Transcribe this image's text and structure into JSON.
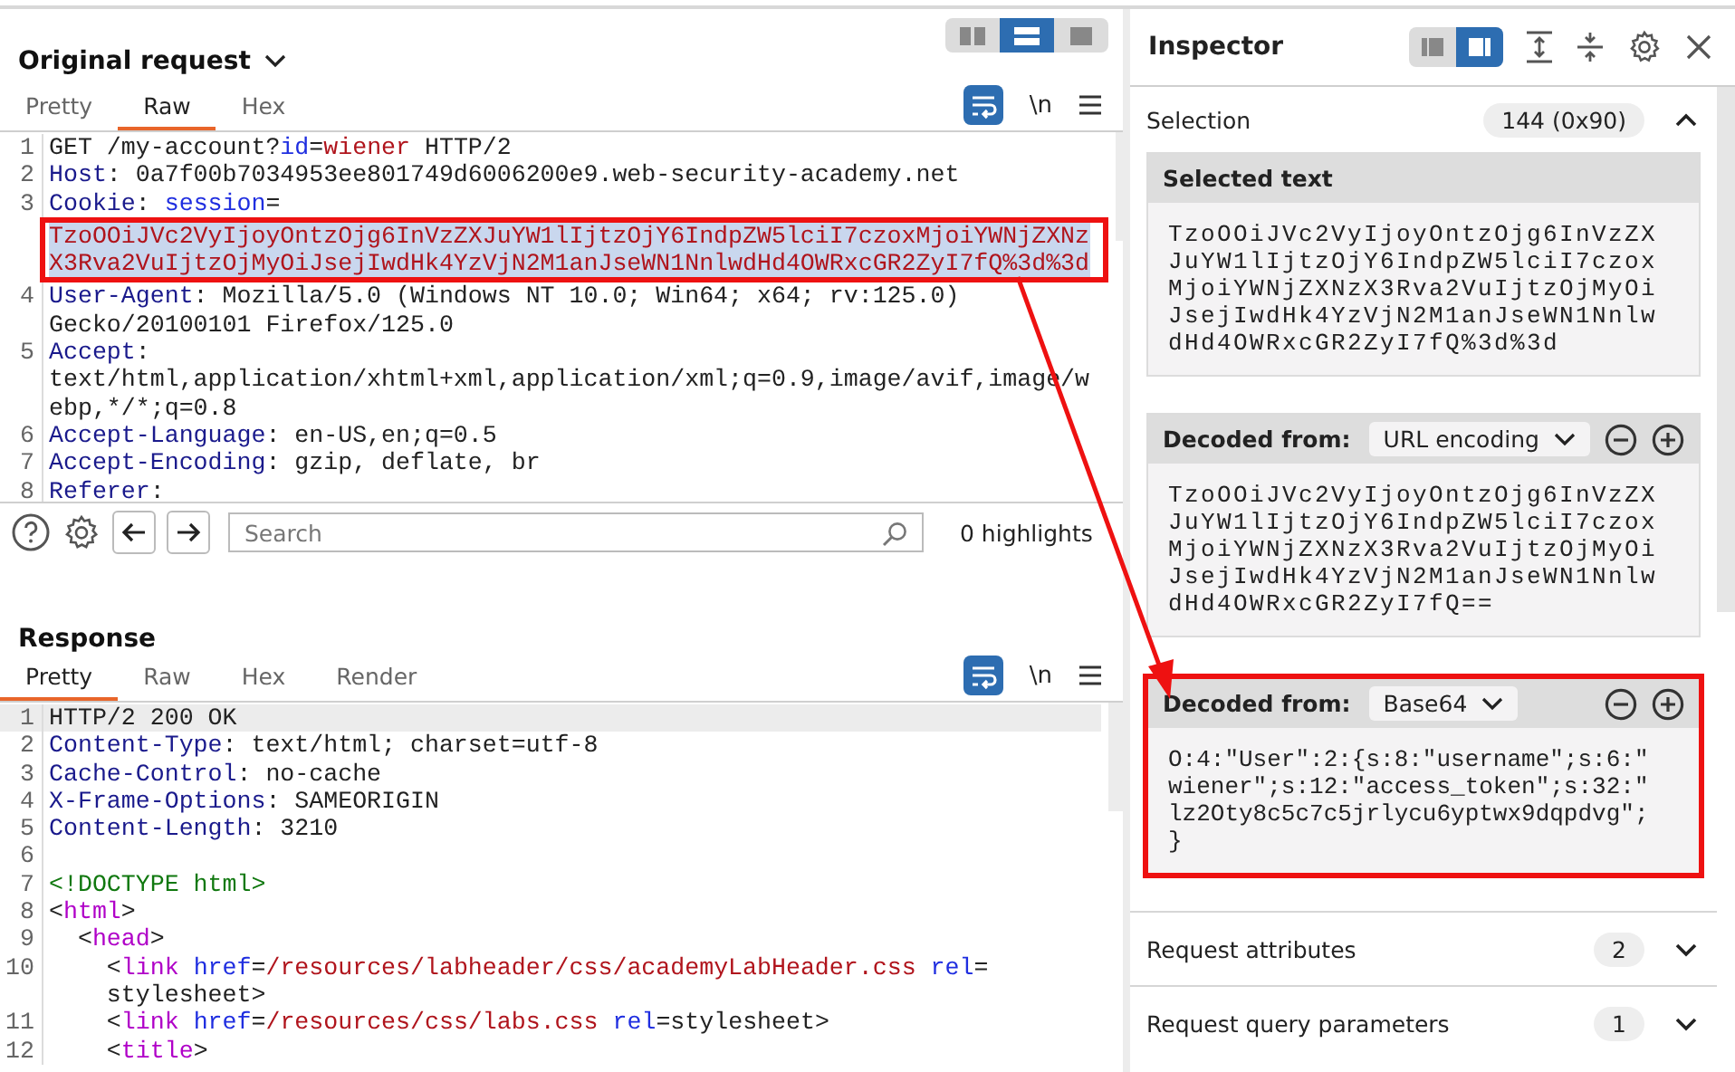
{
  "request": {
    "title": "Original request",
    "layout_modes": [
      {
        "selected": false
      },
      {
        "selected": true
      },
      {
        "selected": false
      }
    ],
    "tabs": [
      {
        "label": "Pretty",
        "selected": false
      },
      {
        "label": "Raw",
        "selected": true
      },
      {
        "label": "Hex",
        "selected": false
      }
    ],
    "wrap_on": true,
    "newline_label": "\\n",
    "lines": [
      {
        "number": "1",
        "rows": [
          [
            {
              "kind": "plain",
              "text": "GET /my-account?"
            },
            {
              "kind": "param",
              "text": "id"
            },
            {
              "kind": "plain",
              "text": "="
            },
            {
              "kind": "val",
              "text": "wiener"
            },
            {
              "kind": "plain",
              "text": " HTTP/2"
            }
          ]
        ]
      },
      {
        "number": "2",
        "rows": [
          [
            {
              "kind": "key",
              "text": "Host"
            },
            {
              "kind": "plain",
              "text": ": 0a7f00b7034953ee801749d6006200e9.web-security-academy.net"
            }
          ]
        ]
      },
      {
        "number": "3",
        "rows": [
          [
            {
              "kind": "key",
              "text": "Cookie"
            },
            {
              "kind": "plain",
              "text": ": "
            },
            {
              "kind": "param",
              "text": "session"
            },
            {
              "kind": "plain",
              "text": "="
            }
          ]
        ],
        "boxed_rows": [
          [
            {
              "kind": "sel",
              "text": "TzoOOiJVc2VyIjoyOntzOjg6InVzZXJuYW1lIjtzOjY6IndpZW5lciI7czoxMjoiYWNjZXNz"
            }
          ],
          [
            {
              "kind": "sel",
              "text": "X3Rva2VuIjtzOjMyOiJsejIwdHk4YzVjN2M1anJseWN1NnlwdHd4OWRxcGR2ZyI7fQ%3d%3d"
            }
          ]
        ]
      },
      {
        "number": "4",
        "rows": [
          [
            {
              "kind": "key",
              "text": "User-Agent"
            },
            {
              "kind": "plain",
              "text": ": Mozilla/5.0 (Windows NT 10.0; Win64; x64; rv:125.0)"
            }
          ],
          [
            {
              "kind": "plain",
              "text": "Gecko/20100101 Firefox/125.0"
            }
          ]
        ]
      },
      {
        "number": "5",
        "rows": [
          [
            {
              "kind": "key",
              "text": "Accept"
            },
            {
              "kind": "plain",
              "text": ":"
            }
          ],
          [
            {
              "kind": "plain",
              "text": "text/html,application/xhtml+xml,application/xml;q=0.9,image/avif,image/w"
            }
          ],
          [
            {
              "kind": "plain",
              "text": "ebp,*/*;q=0.8"
            }
          ]
        ]
      },
      {
        "number": "6",
        "rows": [
          [
            {
              "kind": "key",
              "text": "Accept-Language"
            },
            {
              "kind": "plain",
              "text": ": en-US,en;q=0.5"
            }
          ]
        ]
      },
      {
        "number": "7",
        "rows": [
          [
            {
              "kind": "key",
              "text": "Accept-Encoding"
            },
            {
              "kind": "plain",
              "text": ": gzip, deflate, br"
            }
          ]
        ]
      },
      {
        "number": "8",
        "rows": [
          [
            {
              "kind": "key",
              "text": "Referer"
            },
            {
              "kind": "plain",
              "text": ":"
            }
          ]
        ]
      }
    ],
    "toolbar": {
      "search_placeholder": "Search",
      "highlights": "0 highlights"
    }
  },
  "response": {
    "title": "Response",
    "tabs": [
      {
        "label": "Pretty",
        "selected": true
      },
      {
        "label": "Raw",
        "selected": false
      },
      {
        "label": "Hex",
        "selected": false
      },
      {
        "label": "Render",
        "selected": false
      }
    ],
    "wrap_on": true,
    "newline_label": "\\n",
    "lines": [
      {
        "number": "1",
        "highlighted": true,
        "rows": [
          [
            {
              "kind": "plain",
              "text": "HTTP/2 200 OK"
            }
          ]
        ]
      },
      {
        "number": "2",
        "rows": [
          [
            {
              "kind": "key",
              "text": "Content-Type"
            },
            {
              "kind": "plain",
              "text": ": text/html; charset=utf-8"
            }
          ]
        ]
      },
      {
        "number": "3",
        "rows": [
          [
            {
              "kind": "key",
              "text": "Cache-Control"
            },
            {
              "kind": "plain",
              "text": ": no-cache"
            }
          ]
        ]
      },
      {
        "number": "4",
        "rows": [
          [
            {
              "kind": "key",
              "text": "X-Frame-Options"
            },
            {
              "kind": "plain",
              "text": ": SAMEORIGIN"
            }
          ]
        ]
      },
      {
        "number": "5",
        "rows": [
          [
            {
              "kind": "key",
              "text": "Content-Length"
            },
            {
              "kind": "plain",
              "text": ": 3210"
            }
          ]
        ]
      },
      {
        "number": "6",
        "rows": [
          []
        ]
      },
      {
        "number": "7",
        "rows": [
          [
            {
              "kind": "doctype",
              "text": "<!DOCTYPE html>"
            }
          ]
        ]
      },
      {
        "number": "8",
        "rows": [
          [
            {
              "kind": "plain",
              "text": "<"
            },
            {
              "kind": "tag",
              "text": "html"
            },
            {
              "kind": "plain",
              "text": ">"
            }
          ]
        ]
      },
      {
        "number": "9",
        "rows": [
          [
            {
              "kind": "plain",
              "text": "  <"
            },
            {
              "kind": "tag",
              "text": "head"
            },
            {
              "kind": "plain",
              "text": ">"
            }
          ]
        ]
      },
      {
        "number": "10",
        "rows": [
          [
            {
              "kind": "plain",
              "text": "    <"
            },
            {
              "kind": "tag",
              "text": "link"
            },
            {
              "kind": "plain",
              "text": " "
            },
            {
              "kind": "param",
              "text": "href"
            },
            {
              "kind": "plain",
              "text": "="
            },
            {
              "kind": "val",
              "text": "/resources/labheader/css/academyLabHeader.css"
            },
            {
              "kind": "plain",
              "text": " "
            },
            {
              "kind": "param",
              "text": "rel"
            },
            {
              "kind": "plain",
              "text": "="
            }
          ],
          [
            {
              "kind": "plain",
              "text": "    stylesheet>"
            }
          ]
        ]
      },
      {
        "number": "11",
        "rows": [
          [
            {
              "kind": "plain",
              "text": "    <"
            },
            {
              "kind": "tag",
              "text": "link"
            },
            {
              "kind": "plain",
              "text": " "
            },
            {
              "kind": "param",
              "text": "href"
            },
            {
              "kind": "plain",
              "text": "="
            },
            {
              "kind": "val",
              "text": "/resources/css/labs.css"
            },
            {
              "kind": "plain",
              "text": " "
            },
            {
              "kind": "param",
              "text": "rel"
            },
            {
              "kind": "plain",
              "text": "=stylesheet>"
            }
          ]
        ]
      },
      {
        "number": "12",
        "rows": [
          [
            {
              "kind": "plain",
              "text": "    <"
            },
            {
              "kind": "tag",
              "text": "title"
            },
            {
              "kind": "plain",
              "text": ">"
            }
          ]
        ]
      }
    ]
  },
  "inspector": {
    "title": "Inspector",
    "layout_modes": [
      {
        "selected": false
      },
      {
        "selected": true
      }
    ],
    "selection": {
      "label": "Selection",
      "badge": "144 (0x90)",
      "expanded": true
    },
    "panels": [
      {
        "kind": "selected",
        "title": "Selected text",
        "text": "TzoOOiJVc2VyIjoyOntzOjg6InVzZXJuYW1lIjtzOjY6IndpZW5lciI7czoxMjoiYWNjZXNzX3Rva2VuIjtzOjMyOiJsejIwdHk4YzVjN2M1anJseWN1NnlwdHd4OWRxcGR2ZyI7fQ%3d%3d",
        "boxed": false
      },
      {
        "kind": "decoded",
        "title": "Decoded from:",
        "format": "URL encoding",
        "text": "TzoOOiJVc2VyIjoyOntzOjg6InVzZXJuYW1lIjtzOjY6IndpZW5lciI7czoxMjoiYWNjZXNzX3Rva2VuIjtzOjMyOiJsejIwdHk4YzVjN2M1anJseWN1NnlwdHd4OWRxcGR2ZyI7fQ==",
        "boxed": false
      },
      {
        "kind": "decoded",
        "title": "Decoded from:",
        "format": "Base64",
        "text": "O:4:\"User\":2:{s:8:\"username\";s:6:\"wiener\";s:12:\"access_token\";s:32:\"lz2Oty8c5c7c5jrlycu6yptwx9dqpdvg\";}",
        "boxed": true
      }
    ],
    "sections": [
      {
        "label": "Request attributes",
        "badge": "2",
        "expanded": false
      },
      {
        "label": "Request query parameters",
        "badge": "1",
        "expanded": false
      }
    ]
  },
  "annotations": {
    "arrow": true
  }
}
